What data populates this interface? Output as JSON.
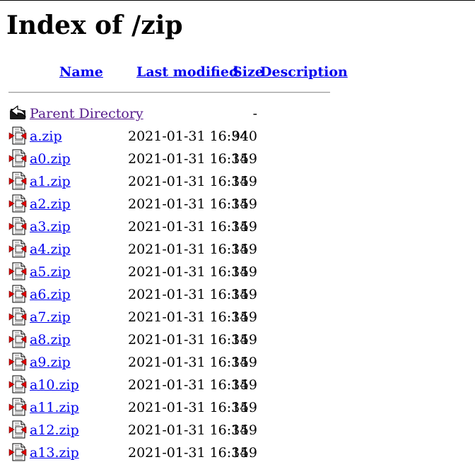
{
  "page": {
    "title": "Index of /zip"
  },
  "columns": {
    "name": "Name",
    "last_modified": "Last modified",
    "size": "Size",
    "description": "Description"
  },
  "parent": {
    "label": "Parent Directory",
    "size": "-",
    "icon": "back-folder-icon"
  },
  "files": [
    {
      "name": "a.zip",
      "modified": "2021-01-31 16:34",
      "size": "940",
      "icon": "compressed-file-icon"
    },
    {
      "name": "a0.zip",
      "modified": "2021-01-31 16:34",
      "size": "159",
      "icon": "compressed-file-icon"
    },
    {
      "name": "a1.zip",
      "modified": "2021-01-31 16:34",
      "size": "159",
      "icon": "compressed-file-icon"
    },
    {
      "name": "a2.zip",
      "modified": "2021-01-31 16:34",
      "size": "159",
      "icon": "compressed-file-icon"
    },
    {
      "name": "a3.zip",
      "modified": "2021-01-31 16:34",
      "size": "159",
      "icon": "compressed-file-icon"
    },
    {
      "name": "a4.zip",
      "modified": "2021-01-31 16:34",
      "size": "159",
      "icon": "compressed-file-icon"
    },
    {
      "name": "a5.zip",
      "modified": "2021-01-31 16:34",
      "size": "159",
      "icon": "compressed-file-icon"
    },
    {
      "name": "a6.zip",
      "modified": "2021-01-31 16:34",
      "size": "159",
      "icon": "compressed-file-icon"
    },
    {
      "name": "a7.zip",
      "modified": "2021-01-31 16:34",
      "size": "159",
      "icon": "compressed-file-icon"
    },
    {
      "name": "a8.zip",
      "modified": "2021-01-31 16:34",
      "size": "159",
      "icon": "compressed-file-icon"
    },
    {
      "name": "a9.zip",
      "modified": "2021-01-31 16:34",
      "size": "159",
      "icon": "compressed-file-icon"
    },
    {
      "name": "a10.zip",
      "modified": "2021-01-31 16:34",
      "size": "159",
      "icon": "compressed-file-icon"
    },
    {
      "name": "a11.zip",
      "modified": "2021-01-31 16:34",
      "size": "159",
      "icon": "compressed-file-icon"
    },
    {
      "name": "a12.zip",
      "modified": "2021-01-31 16:34",
      "size": "159",
      "icon": "compressed-file-icon"
    },
    {
      "name": "a13.zip",
      "modified": "2021-01-31 16:34",
      "size": "159",
      "icon": "compressed-file-icon"
    }
  ],
  "colors": {
    "link": "#0000ee",
    "visited_link": "#551a8b",
    "icon_red": "#e00000"
  }
}
